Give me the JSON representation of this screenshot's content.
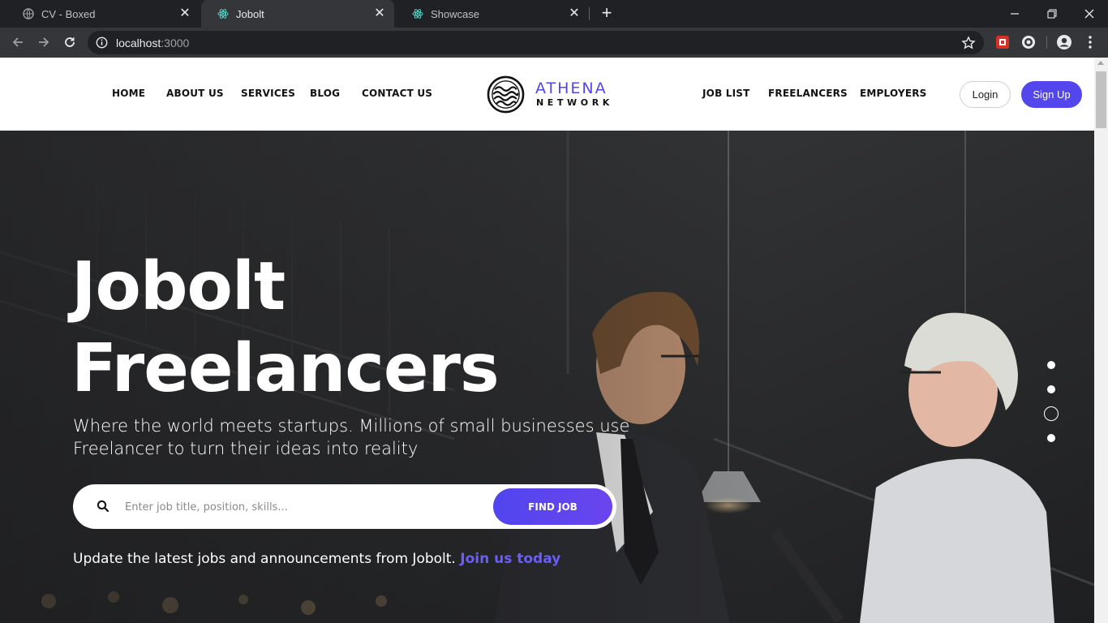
{
  "browser": {
    "tabs": [
      {
        "title": "CV - Boxed",
        "active": false,
        "favicon": "globe-icon"
      },
      {
        "title": "Jobolt",
        "active": true,
        "favicon": "react-icon"
      },
      {
        "title": "Showcase",
        "active": false,
        "favicon": "react-icon"
      }
    ],
    "url_host": "localhost",
    "url_port": ":3000"
  },
  "nav": {
    "left": [
      "HOME",
      "ABOUT US",
      "SERVICES",
      "BLOG",
      "CONTACT US"
    ],
    "right": [
      "JOB LIST",
      "FREELANCERS",
      "EMPLOYERS"
    ],
    "login": "Login",
    "signup": "Sign Up"
  },
  "logo": {
    "name": "ATHENA",
    "sub": "NETWORK"
  },
  "hero": {
    "title_line1": "Jobolt",
    "title_line2": "Freelancers",
    "subtitle": "Where the world meets startups. Millions of small businesses use Freelancer to turn their ideas into reality",
    "search_placeholder": "Enter job title, position, skills...",
    "find_button": "FIND JOB",
    "note_text": "Update the latest jobs and announcements from Jobolt.",
    "note_link": "Join us today",
    "slides_count": 4,
    "active_slide_index": 2
  },
  "colors": {
    "brand": "#5346ec",
    "chrome_bg": "#202124",
    "chrome_toolbar": "#35363a"
  }
}
